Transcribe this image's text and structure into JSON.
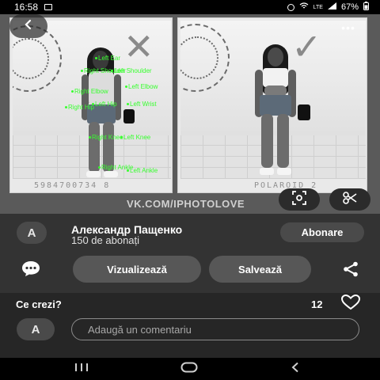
{
  "status_bar": {
    "time": "16:58",
    "battery": "67%",
    "network": "LTE"
  },
  "image": {
    "watermark": "VK.COM/IPHOTOLOVE",
    "serial_left": "5984700734 8",
    "serial_right": "POLAROID 2",
    "keypoint_labels": {
      "left_ear": "Left Ear",
      "right_shoulder": "Right Shoulder",
      "left_shoulder": "Left Shoulder",
      "right_elbow": "Right Elbow",
      "left_elbow": "Left Elbow",
      "right_hip": "Right Hip",
      "left_hip": "Left Hip",
      "right_wrist": "Right Wrist",
      "left_wrist": "Left Wrist",
      "right_knee": "Right Knee",
      "left_knee": "Left Knee",
      "right_ankle": "Right Ankle",
      "left_ankle": "Left Ankle"
    },
    "marks": {
      "left": "✕",
      "right": "✓"
    }
  },
  "icons": {
    "back": "back-arrow-icon",
    "more": "more-icon",
    "lens": "visual-search-icon",
    "crop": "scissors-icon",
    "comment": "comment-icon",
    "share": "share-icon",
    "heart": "heart-icon"
  },
  "author": {
    "avatar_letter": "A",
    "name": "Александр Пащенко",
    "followers": "150 de abonați",
    "follow_label": "Abonare"
  },
  "actions": {
    "view_label": "Vizualizează",
    "save_label": "Salvează"
  },
  "comments": {
    "title": "Ce crezi?",
    "likes": "12",
    "avatar_letter": "A",
    "placeholder": "Adaugă un comentariu"
  },
  "colors": {
    "panel": "#333333",
    "accent_keypoints": "#37ff2e"
  }
}
